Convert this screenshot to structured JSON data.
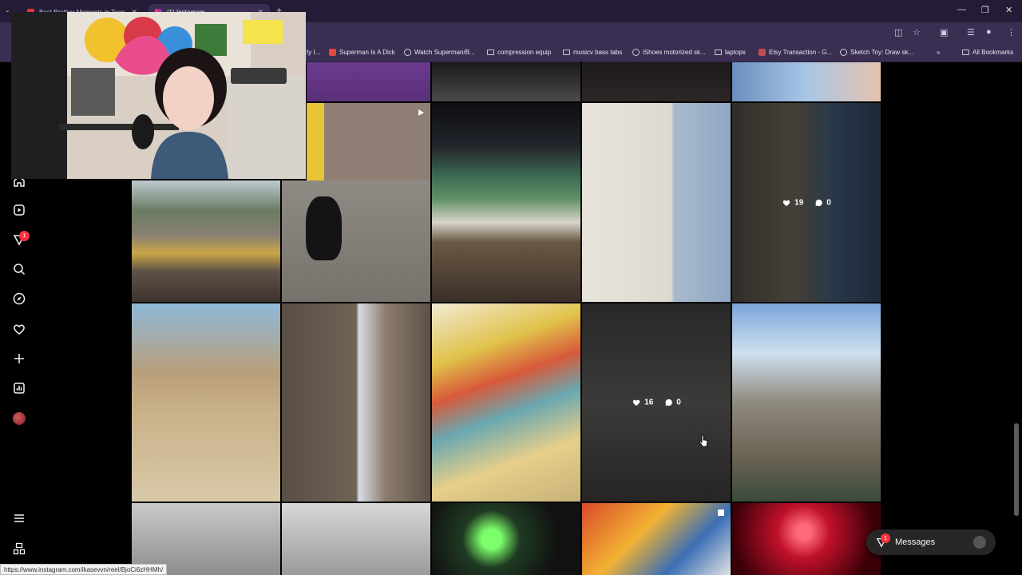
{
  "browser": {
    "tabs": [
      {
        "label": "Best Brother Moments in Teen",
        "color": "#e03c2f"
      },
      {
        "label": "(1) Instagram",
        "color": "#d6249f"
      }
    ],
    "bookmarks": [
      {
        "label": "ty I...",
        "icon": "globe"
      },
      {
        "label": "Superman Is A Dick",
        "icon": "red"
      },
      {
        "label": "Watch Superman/B...",
        "icon": "globe"
      },
      {
        "label": "compression equip",
        "icon": "folder"
      },
      {
        "label": "musicv bass tabs",
        "icon": "folder"
      },
      {
        "label": "iShoes motorized sk...",
        "icon": "globe"
      },
      {
        "label": "laptops",
        "icon": "folder"
      },
      {
        "label": "Etsy Transaction - G...",
        "icon": "mag"
      },
      {
        "label": "Sketch Toy: Draw sk...",
        "icon": "globe"
      }
    ],
    "all_bookmarks": "All Bookmarks",
    "status_url": "https://www.instagram.com/ikasevvn/reel/BjoCi6zHHMh/"
  },
  "sidebar": {
    "notification_count": "1",
    "icons": [
      "home-icon",
      "reels-icon",
      "notifications-icon",
      "search-icon",
      "explore-icon",
      "heart-icon",
      "create-icon",
      "dashboard-icon",
      "profile-avatar",
      "menu-icon",
      "meta-icon"
    ]
  },
  "grid": {
    "hover_tile_1": {
      "likes": "19",
      "comments": "0"
    },
    "hover_tile_2": {
      "likes": "16",
      "comments": "0"
    }
  },
  "messages": {
    "label": "Messages",
    "badge": "1"
  },
  "colors": {
    "ig_red": "#ff3040",
    "bg": "#000000",
    "chrome": "#3a2f52"
  }
}
